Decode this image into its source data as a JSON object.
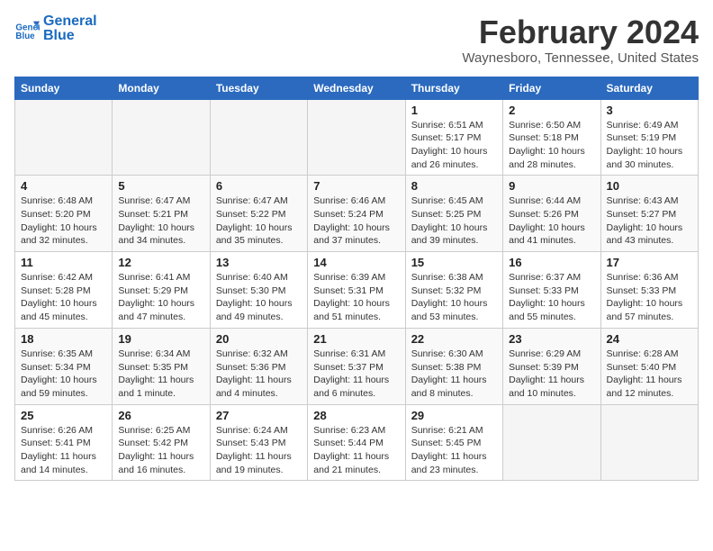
{
  "header": {
    "logo_line1": "General",
    "logo_line2": "Blue",
    "title": "February 2024",
    "subtitle": "Waynesboro, Tennessee, United States"
  },
  "days_of_week": [
    "Sunday",
    "Monday",
    "Tuesday",
    "Wednesday",
    "Thursday",
    "Friday",
    "Saturday"
  ],
  "weeks": [
    [
      {
        "num": "",
        "info": ""
      },
      {
        "num": "",
        "info": ""
      },
      {
        "num": "",
        "info": ""
      },
      {
        "num": "",
        "info": ""
      },
      {
        "num": "1",
        "info": "Sunrise: 6:51 AM\nSunset: 5:17 PM\nDaylight: 10 hours\nand 26 minutes."
      },
      {
        "num": "2",
        "info": "Sunrise: 6:50 AM\nSunset: 5:18 PM\nDaylight: 10 hours\nand 28 minutes."
      },
      {
        "num": "3",
        "info": "Sunrise: 6:49 AM\nSunset: 5:19 PM\nDaylight: 10 hours\nand 30 minutes."
      }
    ],
    [
      {
        "num": "4",
        "info": "Sunrise: 6:48 AM\nSunset: 5:20 PM\nDaylight: 10 hours\nand 32 minutes."
      },
      {
        "num": "5",
        "info": "Sunrise: 6:47 AM\nSunset: 5:21 PM\nDaylight: 10 hours\nand 34 minutes."
      },
      {
        "num": "6",
        "info": "Sunrise: 6:47 AM\nSunset: 5:22 PM\nDaylight: 10 hours\nand 35 minutes."
      },
      {
        "num": "7",
        "info": "Sunrise: 6:46 AM\nSunset: 5:24 PM\nDaylight: 10 hours\nand 37 minutes."
      },
      {
        "num": "8",
        "info": "Sunrise: 6:45 AM\nSunset: 5:25 PM\nDaylight: 10 hours\nand 39 minutes."
      },
      {
        "num": "9",
        "info": "Sunrise: 6:44 AM\nSunset: 5:26 PM\nDaylight: 10 hours\nand 41 minutes."
      },
      {
        "num": "10",
        "info": "Sunrise: 6:43 AM\nSunset: 5:27 PM\nDaylight: 10 hours\nand 43 minutes."
      }
    ],
    [
      {
        "num": "11",
        "info": "Sunrise: 6:42 AM\nSunset: 5:28 PM\nDaylight: 10 hours\nand 45 minutes."
      },
      {
        "num": "12",
        "info": "Sunrise: 6:41 AM\nSunset: 5:29 PM\nDaylight: 10 hours\nand 47 minutes."
      },
      {
        "num": "13",
        "info": "Sunrise: 6:40 AM\nSunset: 5:30 PM\nDaylight: 10 hours\nand 49 minutes."
      },
      {
        "num": "14",
        "info": "Sunrise: 6:39 AM\nSunset: 5:31 PM\nDaylight: 10 hours\nand 51 minutes."
      },
      {
        "num": "15",
        "info": "Sunrise: 6:38 AM\nSunset: 5:32 PM\nDaylight: 10 hours\nand 53 minutes."
      },
      {
        "num": "16",
        "info": "Sunrise: 6:37 AM\nSunset: 5:33 PM\nDaylight: 10 hours\nand 55 minutes."
      },
      {
        "num": "17",
        "info": "Sunrise: 6:36 AM\nSunset: 5:33 PM\nDaylight: 10 hours\nand 57 minutes."
      }
    ],
    [
      {
        "num": "18",
        "info": "Sunrise: 6:35 AM\nSunset: 5:34 PM\nDaylight: 10 hours\nand 59 minutes."
      },
      {
        "num": "19",
        "info": "Sunrise: 6:34 AM\nSunset: 5:35 PM\nDaylight: 11 hours\nand 1 minute."
      },
      {
        "num": "20",
        "info": "Sunrise: 6:32 AM\nSunset: 5:36 PM\nDaylight: 11 hours\nand 4 minutes."
      },
      {
        "num": "21",
        "info": "Sunrise: 6:31 AM\nSunset: 5:37 PM\nDaylight: 11 hours\nand 6 minutes."
      },
      {
        "num": "22",
        "info": "Sunrise: 6:30 AM\nSunset: 5:38 PM\nDaylight: 11 hours\nand 8 minutes."
      },
      {
        "num": "23",
        "info": "Sunrise: 6:29 AM\nSunset: 5:39 PM\nDaylight: 11 hours\nand 10 minutes."
      },
      {
        "num": "24",
        "info": "Sunrise: 6:28 AM\nSunset: 5:40 PM\nDaylight: 11 hours\nand 12 minutes."
      }
    ],
    [
      {
        "num": "25",
        "info": "Sunrise: 6:26 AM\nSunset: 5:41 PM\nDaylight: 11 hours\nand 14 minutes."
      },
      {
        "num": "26",
        "info": "Sunrise: 6:25 AM\nSunset: 5:42 PM\nDaylight: 11 hours\nand 16 minutes."
      },
      {
        "num": "27",
        "info": "Sunrise: 6:24 AM\nSunset: 5:43 PM\nDaylight: 11 hours\nand 19 minutes."
      },
      {
        "num": "28",
        "info": "Sunrise: 6:23 AM\nSunset: 5:44 PM\nDaylight: 11 hours\nand 21 minutes."
      },
      {
        "num": "29",
        "info": "Sunrise: 6:21 AM\nSunset: 5:45 PM\nDaylight: 11 hours\nand 23 minutes."
      },
      {
        "num": "",
        "info": ""
      },
      {
        "num": "",
        "info": ""
      }
    ]
  ]
}
